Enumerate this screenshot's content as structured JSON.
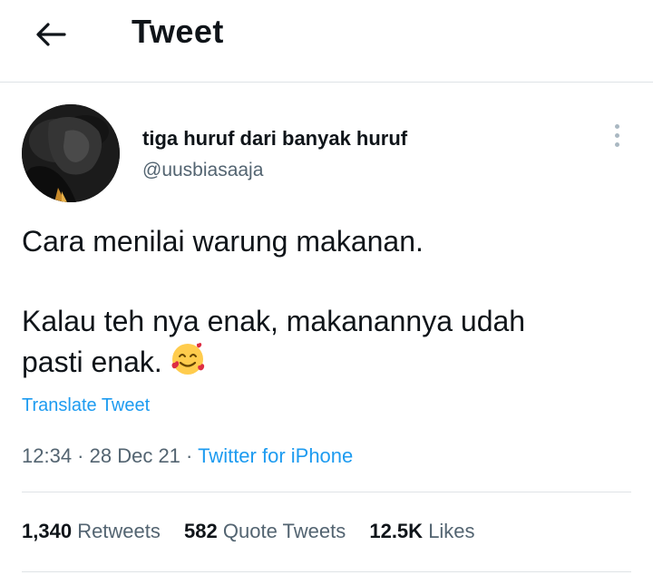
{
  "header": {
    "title": "Tweet",
    "back_icon": "arrow-left-icon"
  },
  "author": {
    "display_name": "tiga huruf dari banyak huruf",
    "handle": "@uusbiasaaja",
    "more_icon": "vertical-ellipsis-icon"
  },
  "tweet": {
    "paragraph_1": "Cara menilai warung makanan.",
    "paragraph_2_line_1": "Kalau teh nya enak, makanannya udah",
    "paragraph_2_line_2": "pasti enak.",
    "emoji_icon": "smiling-face-with-hearts-icon",
    "translate_label": "Translate Tweet"
  },
  "meta": {
    "time": "12:34",
    "separator": " · ",
    "date": "28 Dec 21",
    "separator2": " · ",
    "source": "Twitter for iPhone"
  },
  "stats": {
    "retweets_count": "1,340",
    "retweets_label": "Retweets",
    "quotes_count": "582",
    "quotes_label": "Quote Tweets",
    "likes_count": "12.5K",
    "likes_label": "Likes"
  },
  "colors": {
    "link": "#1d9bf0",
    "secondary_text": "#536471",
    "primary_text": "#0f1419",
    "divider": "#dfe3e6"
  }
}
